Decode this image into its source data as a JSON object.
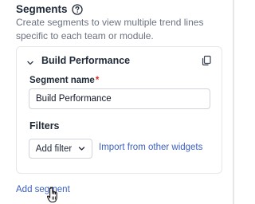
{
  "segments": {
    "title": "Segments",
    "description": "Create segments to view multiple trend lines specific to each team or module.",
    "help_icon": "question-circle-icon",
    "add_segment_label": "Add segment"
  },
  "segment_card": {
    "title": "Build Performance",
    "collapse_icon": "chevron-down-icon",
    "copy_icon": "copy-icon",
    "name_label": "Segment name",
    "required_marker": "*",
    "name_value": "Build Performance",
    "filters_title": "Filters",
    "add_filter_label": "Add filter",
    "import_link_label": "Import from other widgets"
  },
  "colors": {
    "link": "#3b5fc0",
    "required": "#dc2626",
    "border": "#e5e7eb",
    "muted_text": "#6b7280"
  }
}
